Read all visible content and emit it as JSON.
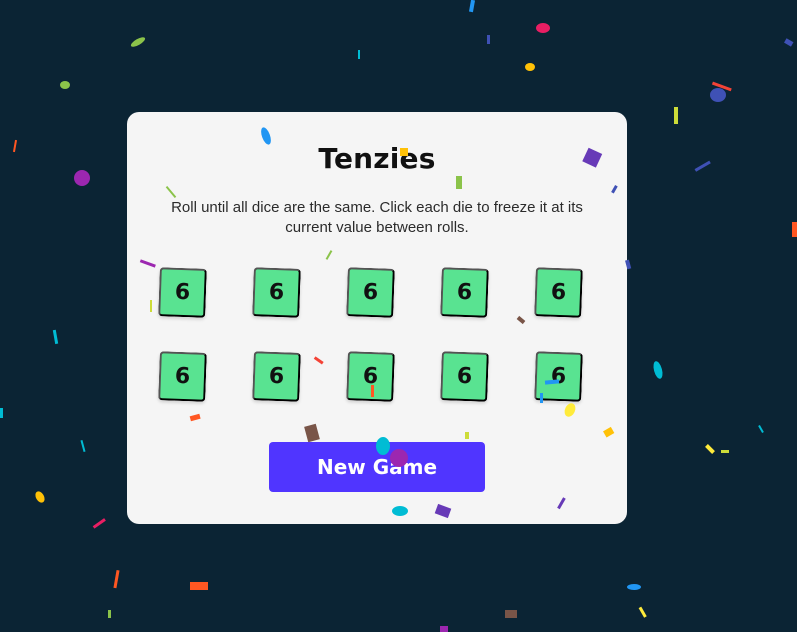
{
  "game": {
    "title": "Tenzies",
    "instructions": "Roll until all dice are the same. Click each die to freeze it at its current value between rolls.",
    "dice": [
      {
        "value": "6",
        "held": true
      },
      {
        "value": "6",
        "held": true
      },
      {
        "value": "6",
        "held": true
      },
      {
        "value": "6",
        "held": true
      },
      {
        "value": "6",
        "held": true
      },
      {
        "value": "6",
        "held": true
      },
      {
        "value": "6",
        "held": true
      },
      {
        "value": "6",
        "held": true
      },
      {
        "value": "6",
        "held": true
      },
      {
        "value": "6",
        "held": true
      }
    ],
    "button_label": "New Game",
    "state": "won"
  },
  "colors": {
    "background": "#0b2434",
    "card": "#f5f5f5",
    "die_held": "#59e391",
    "button": "#5035ff",
    "confetti": [
      "#e91e63",
      "#2196f3",
      "#8bc34a",
      "#9c27b0",
      "#ffc107",
      "#ff5722",
      "#00bcd4",
      "#cddc39",
      "#673ab7",
      "#3f51b5",
      "#795548",
      "#f44336"
    ]
  }
}
